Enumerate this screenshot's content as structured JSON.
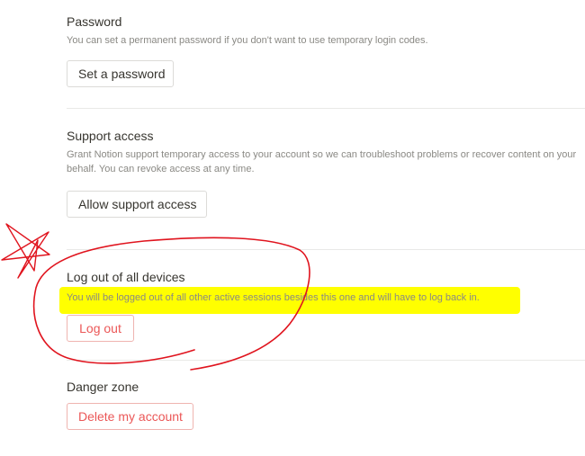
{
  "password": {
    "title": "Password",
    "description": "You can set a permanent password if you don't want to use temporary login codes.",
    "button_label": "Set a password"
  },
  "support_access": {
    "title": "Support access",
    "description_line1": "Grant Notion support temporary access to your account so we can troubleshoot problems or recover content on your",
    "description_line2": "behalf. You can revoke access at any time.",
    "button_label": "Allow support access"
  },
  "logout_all": {
    "title": "Log out of all devices",
    "description": "You will be logged out of all other active sessions besides this one and will have to log back in.",
    "button_label": "Log out"
  },
  "danger_zone": {
    "title": "Danger zone",
    "button_label": "Delete my account"
  },
  "colors": {
    "danger": "#eb5757",
    "highlight": "#ffff00",
    "annotation": "#e0141e"
  }
}
